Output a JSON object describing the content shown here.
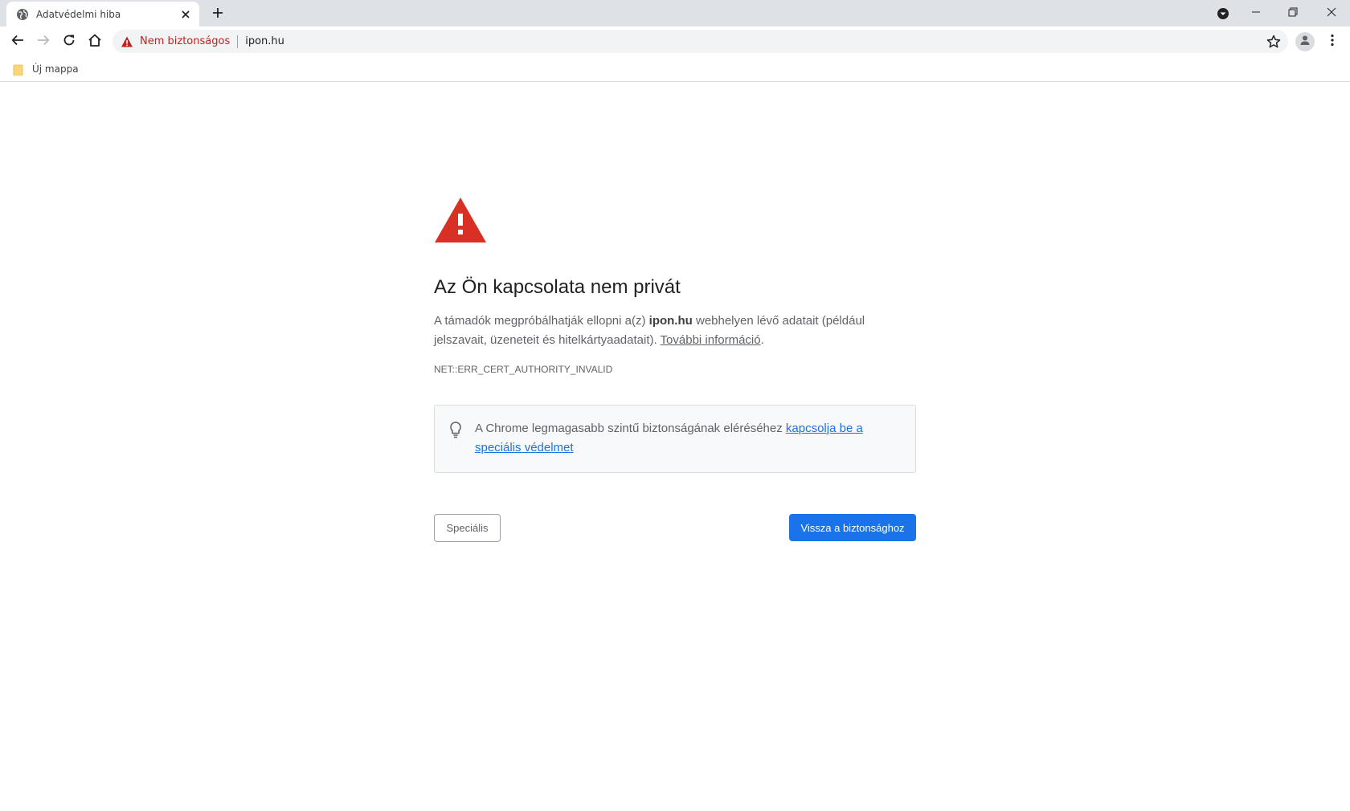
{
  "browser": {
    "tab": {
      "title": "Adatvédelmi hiba",
      "favicon": "globe-icon",
      "close": "close-icon"
    },
    "new_tab": "plus-icon",
    "window_controls": [
      "minimize-icon",
      "restore-icon",
      "close-icon"
    ],
    "toolbar": {
      "buttons": [
        "back-arrow-icon",
        "forward-arrow-icon",
        "reload-icon",
        "home-icon"
      ],
      "security_label": "Nem biztonságos",
      "url": "ipon.hu",
      "warning_color": "#c5221f"
    },
    "bookmarks": [
      {
        "label": "Új mappa",
        "icon": "folder-icon"
      }
    ]
  },
  "interstitial": {
    "heading": "Az Ön kapcsolata nem privát",
    "explain_pre": "A támadók megpróbálhatják ellopni a(z) ",
    "explain_host": "ipon.hu",
    "explain_post": " webhelyen lévő adatait (például jelszavait, üzeneteit és hitelkártyaadatait). ",
    "learn_more": "További információ",
    "explain_end": ".",
    "error_code": "NET::ERR_CERT_AUTHORITY_INVALID",
    "tip_text": "A Chrome legmagasabb szintű biztonságának eléréséhez ",
    "tip_link": "kapcsolja be a speciális védelmet",
    "advanced_button": "Speciális",
    "back_button": "Vissza a biztonsághoz",
    "accent_color": "#1a73e8",
    "warning_icon_color": "#d93025"
  }
}
